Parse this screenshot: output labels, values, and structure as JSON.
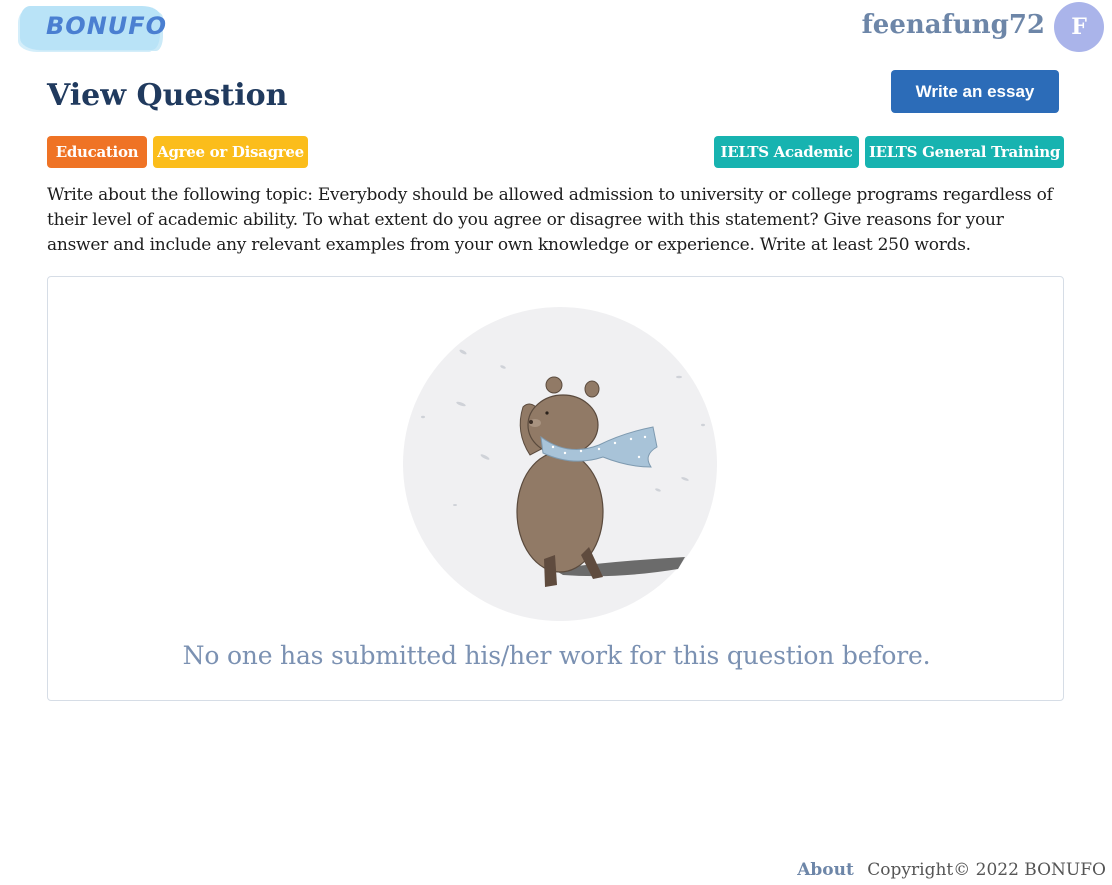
{
  "header": {
    "logo_text": "BONUFO",
    "username": "feenafung72",
    "avatar_initial": "F"
  },
  "page": {
    "title": "View Question",
    "write_button": "Write an essay"
  },
  "tags": {
    "left": [
      "Education",
      "Agree or Disagree"
    ],
    "right": [
      "IELTS Academic",
      "IELTS General Training"
    ]
  },
  "question": {
    "prompt": "Write about the following topic: Everybody should be allowed admission to university or college programs regardless of their level of academic ability. To what extent do you agree or disagree with this statement? Give reasons for your answer and include any relevant examples from your own knowledge or experience. Write at least 250 words."
  },
  "empty_state": {
    "message": "No one has submitted his/her work for this question before.",
    "illustration": "bear-with-scarf-illustration"
  },
  "footer": {
    "about_link": "About",
    "copyright": "Copyright© 2022 BONUFO"
  },
  "colors": {
    "primary_button": "#2c6cb8",
    "tag_education": "#ef7325",
    "tag_agree": "#fbbd1b",
    "tag_ielts": "#17b3b0",
    "avatar": "#aab4ea"
  }
}
